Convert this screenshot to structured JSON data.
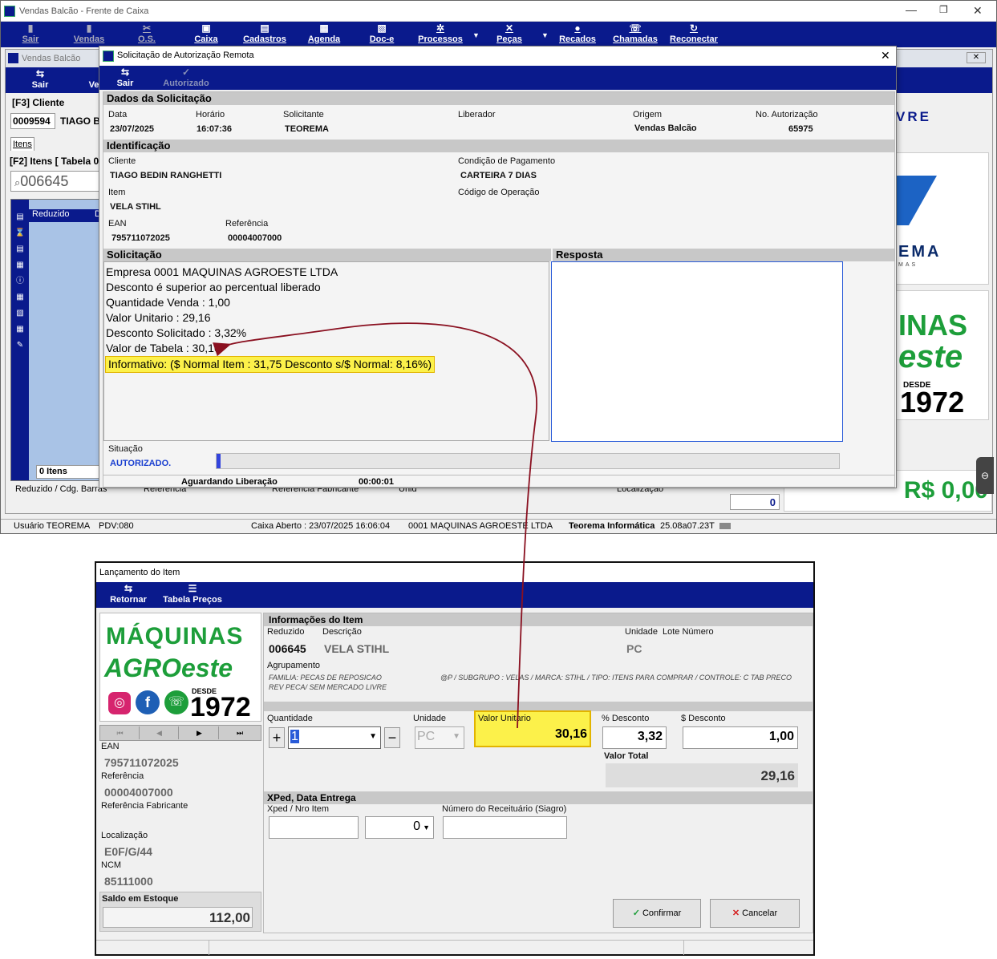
{
  "main_window": {
    "title": "Vendas Balcão - Frente de Caixa",
    "toolbar": [
      {
        "label": "Sair",
        "icon": "exit-icon"
      },
      {
        "label": "Vendas",
        "icon": "cart-icon"
      },
      {
        "label": "O.S.",
        "icon": "tools-icon"
      },
      {
        "label": "Caixa",
        "icon": "cashbox-icon"
      },
      {
        "label": "Cadastros",
        "icon": "register-icon"
      },
      {
        "label": "Agenda",
        "icon": "calendar-icon"
      },
      {
        "label": "Doc-e",
        "icon": "document-icon"
      },
      {
        "label": "Processos",
        "icon": "gear-icon"
      },
      {
        "label": "Peças",
        "icon": "wrench-icon"
      },
      {
        "label": "Recados",
        "icon": "chat-icon"
      },
      {
        "label": "Chamadas",
        "icon": "phone-icon"
      },
      {
        "label": "Reconectar",
        "icon": "refresh-icon"
      }
    ]
  },
  "vendas_window": {
    "title": "Vendas Balcão",
    "sair": "Sair",
    "vendas_short": "Ve",
    "cliente_label": "[F3] Cliente",
    "cliente_code": "0009594",
    "cliente_name": "TIAGO BE",
    "itens_tab": "Itens",
    "itens_label": "[F2] Itens [ Tabela 0",
    "search_value": "006645",
    "col_reduzido": "Reduzido",
    "col_d": "D",
    "itens_count": "0 Itens",
    "footer_cols": [
      "Reduzido / Cdg. Barras",
      "Referência",
      "Referência Fabricante",
      "Unid",
      "Localização"
    ],
    "nro_itens_value": "0",
    "livre_text": "VRE",
    "logo_text": "EMA",
    "logo_sub": "MAS",
    "brand_inas": "INAS",
    "brand_este": "este",
    "brand_desde": "DESDE",
    "brand_year": "1972",
    "total": "R$ 0,00"
  },
  "status_bar": [
    "Usuário TEOREMA",
    "PDV:080",
    "Caixa Aberto : 23/07/2025 16:06:04",
    "0001 MAQUINAS AGROESTE LTDA",
    "Teorema Informática",
    "25.08a07.23T"
  ],
  "auth_dialog": {
    "title": "Solicitação de Autorização Remota",
    "close": "✕",
    "btn_sair": "Sair",
    "btn_autorizado": "Autorizado",
    "dados_title": "Dados da Solicitação",
    "data_label": "Data",
    "data_value": "23/07/2025",
    "horario_label": "Horário",
    "horario_value": "16:07:36",
    "solicitante_label": "Solicitante",
    "solicitante_value": "TEOREMA",
    "liberador_label": "Liberador",
    "origem_label": "Origem",
    "origem_value": "Vendas Balcão",
    "noaut_label": "No. Autorização",
    "noaut_value": "65975",
    "ident_title": "Identificação",
    "cliente_label": "Cliente",
    "cliente_value": "TIAGO BEDIN RANGHETTI",
    "cond_label": "Condição de Pagamento",
    "cond_value": "CARTEIRA 7 DIAS",
    "item_label": "Item",
    "item_value": "VELA STIHL",
    "codop_label": "Código de Operação",
    "ean_label": "EAN",
    "ean_value": "795711072025",
    "ref_label": "Referência",
    "ref_value": "00004007000",
    "solic_title": "Solicitação",
    "resposta_title": "Resposta",
    "solic_lines": [
      "Empresa 0001 MAQUINAS AGROESTE LTDA",
      "Desconto é superior ao percentual liberado",
      "Quantidade Venda : 1,00",
      "Valor Unitario    : 29,16",
      "Desconto Solicitado : 3,32%",
      "Valor de Tabela  : 30,16"
    ],
    "informativo": "Informativo: ($ Normal Item : 31,75 Desconto s/$ Normal: 8,16%)",
    "situacao_label": "Situação",
    "situacao_value": "AUTORIZADO.",
    "aguardando": "Aguardando Liberação",
    "timer": "00:00:01"
  },
  "item_dialog": {
    "title": "Lançamento do Item",
    "btn_retornar": "Retornar",
    "btn_tabela": "Tabela Preços",
    "brand_maquinas": "MÁQUINAS",
    "brand_agroeste": "AGROeste",
    "brand_desde": "DESDE",
    "brand_year": "1972",
    "nav": [
      "⏮",
      "◀",
      "▶",
      "⏭"
    ],
    "ean_label": "EAN",
    "ean_value": "795711072025",
    "ref_label": "Referência",
    "ref_value": "00004007000",
    "reffab_label": "Referência Fabricante",
    "loc_label": "Localização",
    "loc_value": "E0F/G/44",
    "ncm_label": "NCM",
    "ncm_value": "85111000",
    "saldo_label": "Saldo em Estoque",
    "saldo_value": "112,00",
    "info_title": "Informações do Item",
    "reduzido_label": "Reduzido",
    "reduzido_value": "006645",
    "descricao_label": "Descrição",
    "descricao_value": "VELA STIHL",
    "unidade_label": "Unidade",
    "unidade_value": "PC",
    "lote_label": "Lote Número",
    "agrup_label": "Agrupamento",
    "agrup_line1": "FAMILIA: PECAS DE REPOSICAO",
    "agrup_line2": "REV PECA/ SEM MERCADO LIVRE",
    "agrup_right": "@P / SUBGRUPO : VELAS / MARCA: STIHL / TIPO: ITENS PARA COMPRAR / CONTROLE: C TAB PRECO",
    "qtd_label": "Quantidade",
    "qtd_value": "1",
    "unid_label": "Unidade",
    "unid_value": "PC",
    "vunit_label": "Valor Unitario",
    "vunit_value": "30,16",
    "pdesc_label": "% Desconto",
    "pdesc_value": "3,32",
    "sdesc_label": "$ Desconto",
    "sdesc_value": "1,00",
    "vtotal_label": "Valor Total",
    "vtotal_value": "29,16",
    "xped_title": "XPed, Data Entrega",
    "xped_label": "Xped / Nro Item",
    "xped_item_value": "0",
    "receit_label": "Número do Receituário (Siagro)",
    "confirmar": "Confirmar",
    "cancelar": "Cancelar"
  }
}
